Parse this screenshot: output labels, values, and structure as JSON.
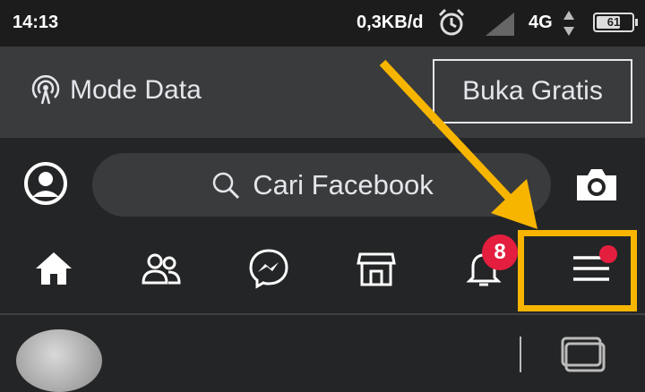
{
  "status_bar": {
    "time": "14:13",
    "speed": "0,3KB/d",
    "network": "4G",
    "battery": "61"
  },
  "data_bar": {
    "mode_label": "Mode Data",
    "free_button": "Buka Gratis"
  },
  "top_bar": {
    "search_placeholder": "Cari Facebook"
  },
  "nav": {
    "notification_count": "8",
    "tabs": [
      "home-icon",
      "friends-icon",
      "messenger-icon",
      "marketplace-icon",
      "bell-icon",
      "menu-icon"
    ]
  },
  "colors": {
    "highlight": "#f7b500",
    "badge": "#e41e3f",
    "background": "#242526"
  }
}
